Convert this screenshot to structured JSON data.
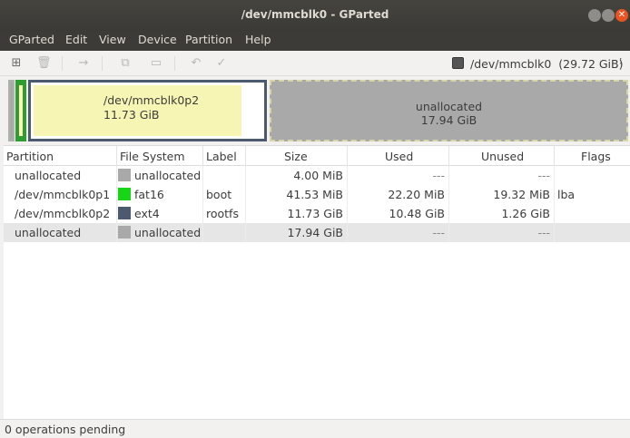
{
  "window": {
    "title": "/dev/mmcblk0 - GParted"
  },
  "menu": {
    "items": [
      "GParted",
      "Edit",
      "View",
      "Device",
      "Partition",
      "Help"
    ]
  },
  "device": {
    "label": "/dev/mmcblk0",
    "size": "(29.72 GiB)"
  },
  "diskmap": {
    "p2_name": "/dev/mmcblk0p2",
    "p2_size": "11.73 GiB",
    "unalloc_name": "unallocated",
    "unalloc_size": "17.94 GiB"
  },
  "columns": [
    "Partition",
    "File System",
    "Label",
    "Size",
    "Used",
    "Unused",
    "Flags"
  ],
  "rows": [
    {
      "partition": "unallocated",
      "fs": "unallocated",
      "fs_color": "#a9a9a9",
      "label": "",
      "size": "4.00 MiB",
      "used": "---",
      "unused": "---",
      "flags": ""
    },
    {
      "partition": "/dev/mmcblk0p1",
      "fs": "fat16",
      "fs_color": "#18d518",
      "label": "boot",
      "size": "41.53 MiB",
      "used": "22.20 MiB",
      "unused": "19.32 MiB",
      "flags": "lba"
    },
    {
      "partition": "/dev/mmcblk0p2",
      "fs": "ext4",
      "fs_color": "#4b5a6f",
      "label": "rootfs",
      "size": "11.73 GiB",
      "used": "10.48 GiB",
      "unused": "1.26 GiB",
      "flags": ""
    },
    {
      "partition": "unallocated",
      "fs": "unallocated",
      "fs_color": "#a9a9a9",
      "label": "",
      "size": "17.94 GiB",
      "used": "---",
      "unused": "---",
      "flags": ""
    }
  ],
  "status": {
    "text": "0 operations pending"
  }
}
